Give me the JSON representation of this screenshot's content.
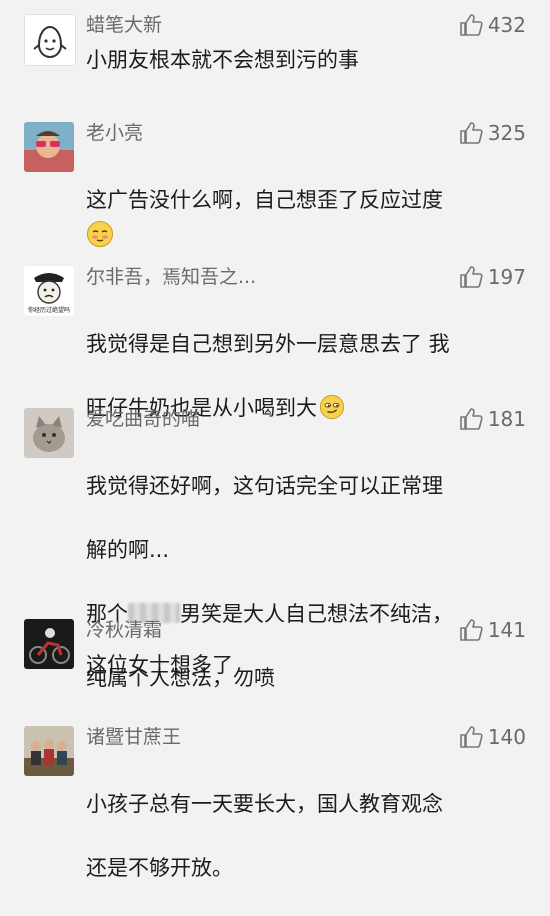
{
  "comments": [
    {
      "name": "蜡笔大新",
      "likes": "432",
      "text": "小朋友根本就不会想到污的事"
    },
    {
      "name": "老小亮",
      "likes": "325",
      "text": "这广告没什么啊，自己想歪了反应过度"
    },
    {
      "name": "尔非吾，焉知吾之...",
      "likes": "197",
      "text_line1": "我觉得是自己想到另外一层意思去了 我",
      "text_line2": "旺仔牛奶也是从小喝到大",
      "avatar_caption": "你经历过绝望吗"
    },
    {
      "name": "爱吃曲奇的喵",
      "likes": "181",
      "text_line1": "我觉得还好啊，这句话完全可以正常理",
      "text_line2": "解的啊...",
      "text_line3a": "那个",
      "text_line3b": "男笑是大人自己想法不纯洁，",
      "text_line4": "纯属个人想法，勿喷"
    },
    {
      "name": "冷秋清霜",
      "likes": "141",
      "text": "这位女士想多了"
    },
    {
      "name": "诸暨甘蔗王",
      "likes": "140",
      "text_line1": "小孩子总有一天要长大，国人教育观念",
      "text_line2": "还是不够开放。"
    }
  ],
  "icons": {
    "like": "thumbs-up-icon",
    "emoji_blush": "blushing-emoji-icon",
    "emoji_smirk": "smirking-emoji-icon"
  },
  "colors": {
    "background": "#f2f2f2",
    "name": "#6a6a6a",
    "text": "#1c1c1c"
  }
}
